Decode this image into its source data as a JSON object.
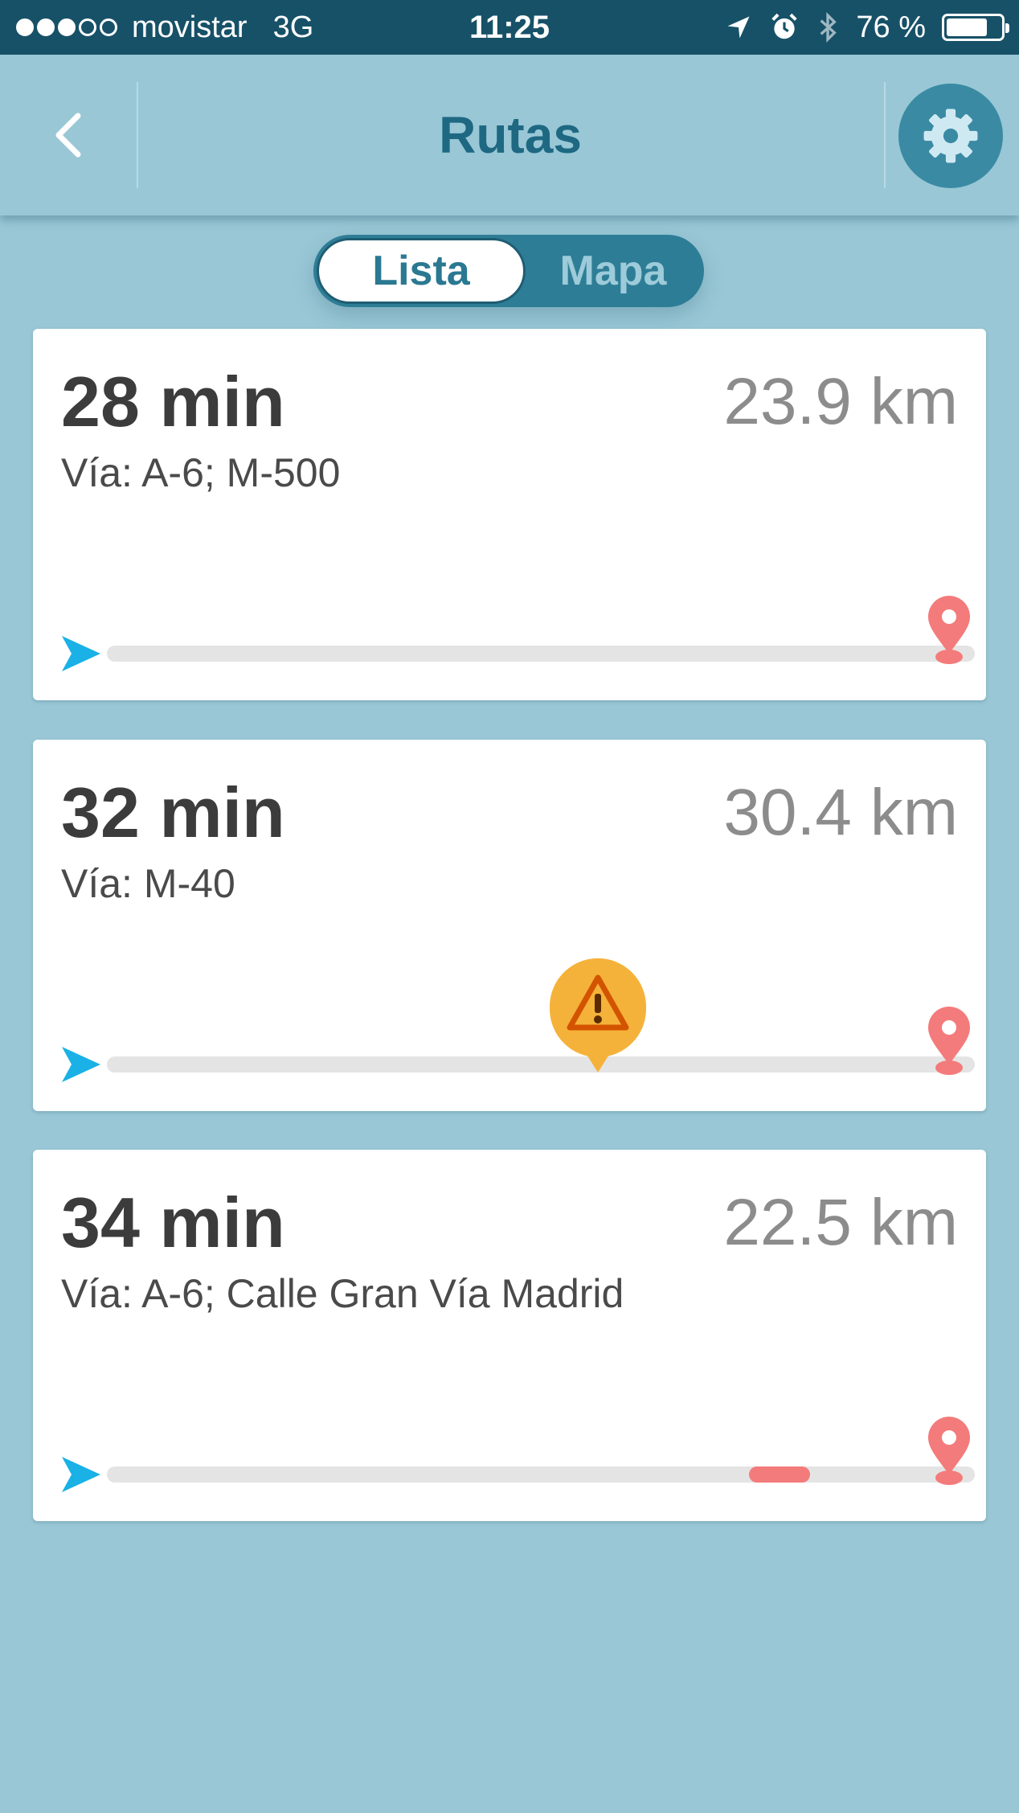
{
  "status_bar": {
    "signal_filled": 3,
    "signal_empty": 2,
    "carrier": "movistar",
    "network": "3G",
    "time": "11:25",
    "battery_text": "76 %",
    "battery_level": 0.76
  },
  "header": {
    "title": "Rutas",
    "back_icon": "chevron-left-icon",
    "settings_icon": "gear-icon"
  },
  "tabs": [
    {
      "label": "Lista",
      "active": true
    },
    {
      "label": "Mapa",
      "active": false
    }
  ],
  "routes": [
    {
      "time": "28 min",
      "distance": "23.9 km",
      "via": "Vía: A-6; M-500"
    },
    {
      "time": "32 min",
      "distance": "30.4 km",
      "via": "Vía: M-40",
      "alert_icon": "warning-icon"
    },
    {
      "time": "34 min",
      "distance": "22.5 km",
      "via": "Vía: A-6; Calle Gran Vía Madrid",
      "traffic_segment": [
        0.74,
        0.81
      ]
    }
  ],
  "colors": {
    "status_bar": "#175168",
    "background": "#99c7d6",
    "accent": "#1e6882",
    "start_marker": "#19b1e6",
    "end_marker": "#f47b7b",
    "alert": "#f5b23a",
    "alert_border": "#d35400"
  }
}
